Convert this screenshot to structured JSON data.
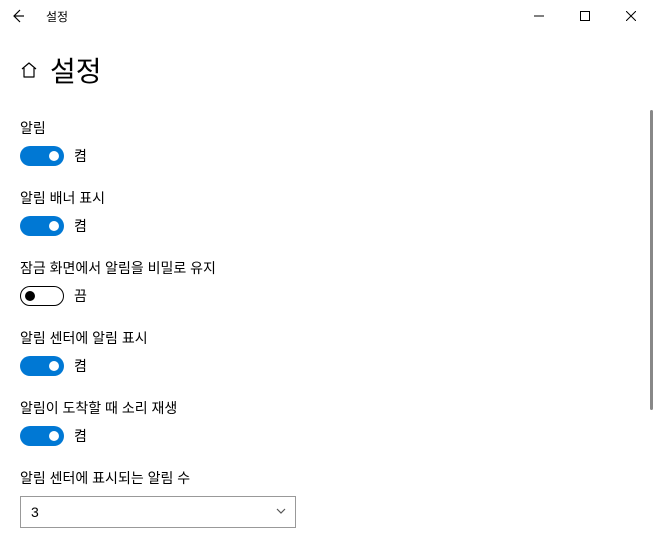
{
  "window": {
    "title": "설정"
  },
  "page": {
    "title": "설정"
  },
  "toggle_states": {
    "on": "켬",
    "off": "끔"
  },
  "settings": {
    "notifications": {
      "label": "알림",
      "on": true
    },
    "show_banner": {
      "label": "알림 배너 표시",
      "on": true
    },
    "keep_private_lockscreen": {
      "label": "잠금 화면에서 알림을 비밀로 유지",
      "on": false
    },
    "show_in_action_center": {
      "label": "알림 센터에 알림 표시",
      "on": true
    },
    "play_sound": {
      "label": "알림이 도착할 때 소리 재생",
      "on": true
    }
  },
  "dropdown": {
    "label": "알림 센터에 표시되는 알림 수",
    "value": "3"
  }
}
